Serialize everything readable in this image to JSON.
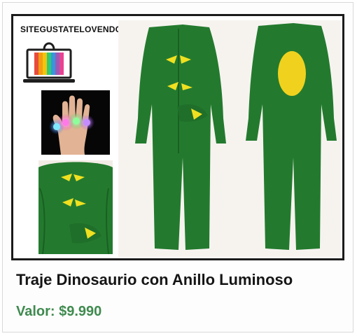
{
  "brand": {
    "text": "SITEGUSTATELOVENDOATI"
  },
  "product": {
    "title": "Traje Dinosaurio con Anillo Luminoso",
    "price_label": "Valor: $9.990"
  },
  "colors": {
    "costume_green": "#237a2e",
    "costume_dark": "#1a5f23",
    "spike_yellow": "#f0e020",
    "price_green": "#3f8a4f",
    "frame_border": "#1b1b1b"
  },
  "icons": [
    "shopping-bag-laptop-icon"
  ]
}
